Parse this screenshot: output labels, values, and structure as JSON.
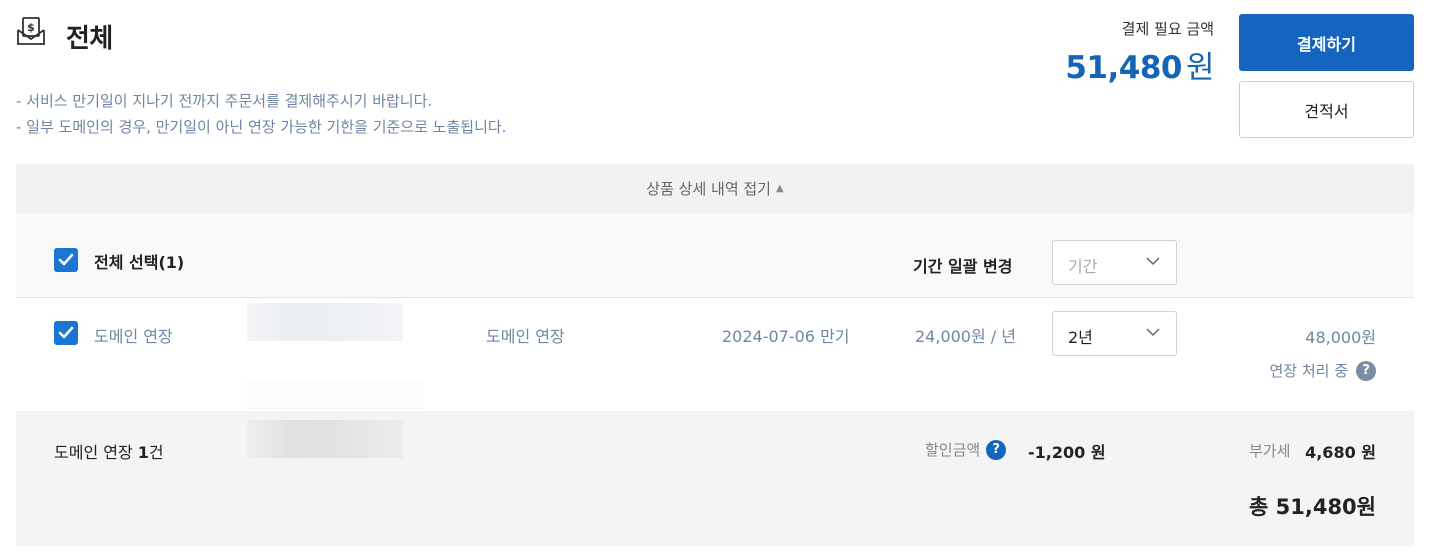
{
  "header": {
    "title": "전체",
    "title_icon": "money-document-icon",
    "notices": [
      "- 서비스 만기일이 지나기 전까지 주문서를 결제해주시기 바랍니다.",
      "- 일부 도메인의 경우, 만기일이 아닌 연장 가능한 기한을 기준으로 노출됩니다."
    ]
  },
  "payment": {
    "label": "결제 필요 금액",
    "amount": "51,480",
    "unit": "원",
    "pay_button": "결제하기",
    "quote_button": "견적서"
  },
  "details": {
    "collapse_label": "상품 상세 내역 접기",
    "select_all_label": "전체 선택(1)",
    "bulk_period_label": "기간 일괄 변경",
    "bulk_period_placeholder": "기간"
  },
  "items": [
    {
      "name": "도메인 연장",
      "type": "도메인 연장",
      "expiry": "2024-07-06 만기",
      "unit_price": "24,000원 / 년",
      "period": "2년",
      "total": "48,000원",
      "status": "연장 처리 중",
      "checked": true
    }
  ],
  "summary": {
    "label_prefix": "도메인 연장 ",
    "count": "1",
    "count_unit": "건",
    "discount_label": "할인금액",
    "discount_value": "-1,200 원",
    "vat_label": "부가세",
    "vat_value": "4,680 원",
    "total": "총 51,480원"
  },
  "colors": {
    "primary": "#1565c0",
    "amount_blue": "#1565b6",
    "muted_text": "#6e86a3",
    "checkbox": "#1976d2"
  }
}
